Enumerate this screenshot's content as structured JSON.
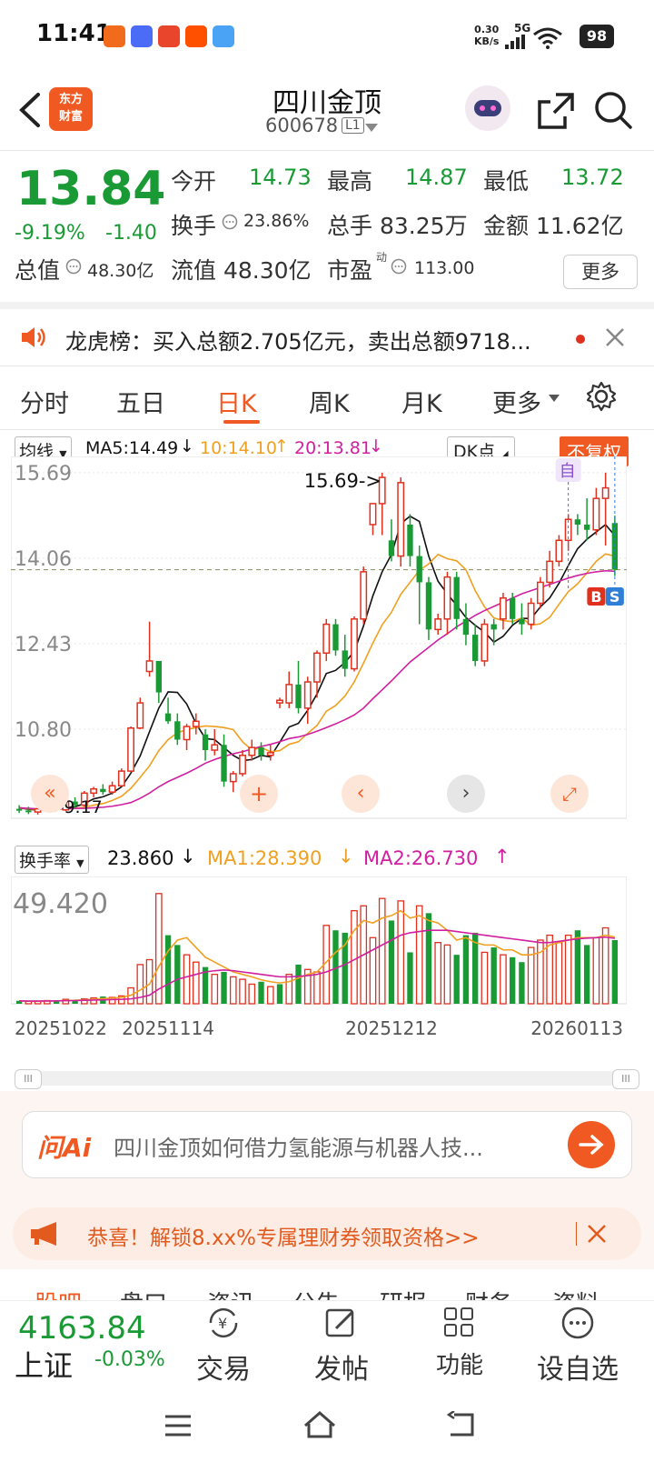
{
  "status_bar": {
    "time": "11:41",
    "net_speed_value": "0.30",
    "net_speed_unit": "KB/s",
    "network": "5G",
    "battery": "98"
  },
  "header": {
    "stock_name": "四川金顶",
    "stock_code": "600678",
    "level": "L1",
    "logo_line1": "东方",
    "logo_line2": "财富"
  },
  "quote": {
    "price": "13.84",
    "change_pct": "-9.19%",
    "change": "-1.40",
    "open_label": "今开",
    "open": "14.73",
    "high_label": "最高",
    "high": "14.87",
    "low_label": "最低",
    "low": "13.72",
    "turnover_label": "换手",
    "turnover": "23.86%",
    "volume_label": "总手",
    "volume": "83.25万",
    "amount_label": "金额",
    "amount": "11.62亿",
    "mktcap_label": "总值",
    "mktcap": "48.30亿",
    "float_label": "流值",
    "float": "48.30亿",
    "pe_label": "市盈",
    "pe_sup": "动",
    "pe": "113.00",
    "more_label": "更多"
  },
  "notice": {
    "text": "龙虎榜：买入总额2.705亿元，卖出总额9718..."
  },
  "kline_tabs": [
    {
      "label": "分时"
    },
    {
      "label": "五日"
    },
    {
      "label": "日K"
    },
    {
      "label": "周K"
    },
    {
      "label": "月K"
    },
    {
      "label": "更多"
    }
  ],
  "chart_legend": {
    "ma_select": "均线",
    "ma5": "MA5:14.49",
    "ma10": "10:14.10",
    "ma20": "20:13.81",
    "dk_select": "DK点",
    "fuquan": "不复权",
    "vol_select": "换手率",
    "vol_val": "23.860",
    "vol_ma1": "MA1:28.390",
    "vol_ma2": "MA2:26.730"
  },
  "colors": {
    "up": "#e0301e",
    "down": "#1a9a35",
    "ma5": "#111111",
    "ma10": "#f0a020",
    "ma20": "#d020a0",
    "accent": "#f05a22"
  },
  "chart_data": {
    "type": "candlestick",
    "y_ticks": [
      "15.69",
      "14.06",
      "12.43",
      "10.80"
    ],
    "ylim": [
      9.1,
      16.0
    ],
    "high_annotation": "15.69->",
    "low_annotation": "<-9.17",
    "markers": {
      "zi": "自",
      "b": "B",
      "s": "S"
    },
    "ohlc": [
      [
        9.28,
        9.35,
        9.2,
        9.25
      ],
      [
        9.25,
        9.32,
        9.18,
        9.22
      ],
      [
        9.22,
        9.3,
        9.17,
        9.28
      ],
      [
        9.28,
        9.36,
        9.22,
        9.3
      ],
      [
        9.3,
        9.38,
        9.25,
        9.26
      ],
      [
        9.26,
        9.45,
        9.24,
        9.42
      ],
      [
        9.42,
        9.5,
        9.3,
        9.35
      ],
      [
        9.35,
        9.62,
        9.32,
        9.58
      ],
      [
        9.58,
        9.7,
        9.5,
        9.66
      ],
      [
        9.66,
        9.75,
        9.55,
        9.6
      ],
      [
        9.6,
        9.8,
        9.55,
        9.72
      ],
      [
        9.72,
        10.05,
        9.7,
        10.0
      ],
      [
        10.0,
        10.85,
        9.98,
        10.82
      ],
      [
        10.82,
        11.4,
        10.8,
        11.3
      ],
      [
        11.9,
        12.85,
        11.8,
        12.1
      ],
      [
        12.1,
        12.1,
        11.3,
        11.5
      ],
      [
        11.1,
        11.4,
        10.9,
        10.95
      ],
      [
        10.95,
        11.1,
        10.5,
        10.6
      ],
      [
        10.6,
        10.9,
        10.4,
        10.85
      ],
      [
        10.85,
        11.1,
        10.7,
        10.95
      ],
      [
        10.7,
        10.8,
        10.2,
        10.4
      ],
      [
        10.4,
        10.8,
        10.3,
        10.5
      ],
      [
        10.5,
        10.7,
        9.7,
        9.8
      ],
      [
        9.8,
        10.0,
        9.6,
        9.95
      ],
      [
        9.95,
        10.4,
        9.9,
        10.3
      ],
      [
        10.3,
        10.6,
        10.2,
        10.45
      ],
      [
        10.45,
        10.55,
        10.2,
        10.3
      ],
      [
        10.3,
        10.5,
        10.2,
        10.35
      ],
      [
        11.3,
        11.4,
        11.2,
        11.35
      ],
      [
        11.3,
        11.9,
        11.2,
        11.65
      ],
      [
        11.65,
        12.1,
        11.1,
        11.2
      ],
      [
        11.2,
        11.8,
        10.9,
        11.7
      ],
      [
        11.7,
        12.3,
        11.4,
        12.25
      ],
      [
        12.25,
        12.9,
        12.1,
        12.8
      ],
      [
        12.8,
        12.9,
        12.2,
        12.3
      ],
      [
        12.3,
        12.6,
        11.8,
        11.95
      ],
      [
        11.95,
        12.95,
        11.9,
        12.9
      ],
      [
        12.9,
        13.9,
        12.8,
        13.8
      ],
      [
        14.7,
        15.0,
        14.5,
        15.1
      ],
      [
        15.1,
        15.69,
        14.5,
        15.6
      ],
      [
        14.4,
        14.8,
        14.0,
        14.1
      ],
      [
        14.1,
        15.6,
        13.9,
        15.5
      ],
      [
        14.7,
        14.9,
        13.9,
        14.1
      ],
      [
        14.1,
        14.3,
        12.8,
        13.6
      ],
      [
        13.6,
        13.7,
        12.5,
        12.7
      ],
      [
        12.7,
        13.0,
        12.6,
        12.9
      ],
      [
        12.9,
        13.8,
        12.6,
        13.7
      ],
      [
        13.7,
        13.8,
        12.7,
        12.9
      ],
      [
        12.9,
        13.2,
        12.4,
        12.6
      ],
      [
        12.6,
        12.8,
        12.0,
        12.1
      ],
      [
        12.1,
        12.9,
        12.0,
        12.8
      ],
      [
        12.8,
        12.9,
        12.4,
        12.7
      ],
      [
        12.9,
        13.4,
        12.7,
        13.3
      ],
      [
        13.3,
        13.4,
        12.8,
        12.9
      ],
      [
        12.9,
        13.2,
        12.6,
        12.8
      ],
      [
        12.8,
        13.3,
        12.7,
        13.2
      ],
      [
        13.2,
        13.7,
        13.1,
        13.6
      ],
      [
        13.6,
        14.2,
        13.5,
        14.0
      ],
      [
        14.0,
        14.5,
        13.9,
        14.4
      ],
      [
        14.4,
        14.9,
        14.2,
        14.8
      ],
      [
        14.8,
        14.9,
        14.5,
        14.7
      ],
      [
        14.7,
        15.2,
        14.4,
        14.6
      ],
      [
        14.6,
        15.4,
        14.5,
        15.2
      ],
      [
        15.2,
        15.69,
        14.3,
        15.4
      ],
      [
        14.73,
        14.87,
        13.72,
        13.84
      ]
    ],
    "ma5": [
      9.3,
      9.27,
      9.26,
      9.27,
      9.26,
      9.3,
      9.32,
      9.38,
      9.47,
      9.51,
      9.58,
      9.7,
      9.96,
      10.29,
      10.75,
      11.2,
      11.51,
      11.5,
      11.28,
      10.91,
      10.62,
      10.6,
      10.45,
      10.3,
      10.2,
      10.22,
      10.3,
      10.27,
      10.55,
      10.84,
      10.91,
      11.16,
      11.47,
      11.86,
      11.92,
      12.07,
      12.28,
      12.77,
      13.34,
      13.8,
      14.13,
      14.72,
      14.86,
      14.76,
      14.1,
      13.62,
      13.38,
      13.16,
      12.93,
      12.78,
      12.65,
      12.46,
      12.57,
      12.78,
      12.91,
      12.91,
      13.13,
      13.3,
      13.58,
      13.92,
      14.24,
      14.42,
      14.56,
      14.7,
      14.49
    ],
    "ma10": [
      9.3,
      9.28,
      9.27,
      9.27,
      9.27,
      9.28,
      9.29,
      9.31,
      9.35,
      9.38,
      9.44,
      9.52,
      9.67,
      9.88,
      10.1,
      10.39,
      10.6,
      10.73,
      10.79,
      10.83,
      10.86,
      10.85,
      10.83,
      10.79,
      10.56,
      10.4,
      10.45,
      10.37,
      10.39,
      10.51,
      10.56,
      10.72,
      10.87,
      11.14,
      11.25,
      11.43,
      11.7,
      12.06,
      12.44,
      12.79,
      13.03,
      13.37,
      13.6,
      13.83,
      13.95,
      14.13,
      14.05,
      14.01,
      13.84,
      13.44,
      13.13,
      12.92,
      12.87,
      12.85,
      12.92,
      12.78,
      12.81,
      12.93,
      13.18,
      13.42,
      13.57,
      13.78,
      14.0,
      14.14,
      14.1
    ],
    "ma20": [
      9.3,
      9.29,
      9.28,
      9.28,
      9.28,
      9.28,
      9.29,
      9.29,
      9.3,
      9.31,
      9.33,
      9.36,
      9.4,
      9.48,
      9.58,
      9.7,
      9.8,
      9.88,
      9.96,
      10.05,
      10.15,
      10.22,
      10.28,
      10.33,
      10.37,
      10.42,
      10.47,
      10.51,
      10.56,
      10.62,
      10.65,
      10.7,
      10.76,
      10.83,
      10.9,
      10.98,
      11.07,
      11.2,
      11.38,
      11.55,
      11.72,
      11.9,
      12.08,
      12.22,
      12.36,
      12.5,
      12.62,
      12.75,
      12.86,
      12.97,
      13.06,
      13.14,
      13.22,
      13.3,
      13.38,
      13.44,
      13.5,
      13.56,
      13.62,
      13.68,
      13.73,
      13.77,
      13.8,
      13.82,
      13.81
    ],
    "volume_max_label": "49.420",
    "volume": [
      1.2,
      1.0,
      1.1,
      1.3,
      1.4,
      1.8,
      1.5,
      2.0,
      2.4,
      3.0,
      2.6,
      3.2,
      6.5,
      16,
      18,
      45,
      28,
      24,
      20,
      17,
      15,
      12,
      13,
      11,
      10,
      8,
      9,
      7,
      8,
      12,
      16,
      14,
      13,
      32,
      30,
      29,
      38,
      40,
      27,
      43,
      34,
      42,
      21,
      40,
      37,
      25,
      24,
      20,
      28,
      29,
      21,
      23,
      20,
      19,
      17,
      23,
      26,
      28,
      25,
      28,
      30,
      24,
      27,
      31,
      26
    ],
    "volume_up": [
      false,
      true,
      true,
      true,
      false,
      true,
      false,
      true,
      true,
      false,
      true,
      true,
      true,
      true,
      true,
      true,
      false,
      false,
      true,
      true,
      false,
      true,
      false,
      true,
      true,
      true,
      false,
      true,
      false,
      true,
      false,
      true,
      true,
      true,
      false,
      false,
      true,
      true,
      true,
      true,
      false,
      true,
      false,
      true,
      false,
      true,
      true,
      false,
      false,
      false,
      true,
      false,
      true,
      false,
      false,
      true,
      true,
      true,
      true,
      true,
      false,
      false,
      true,
      true,
      false
    ],
    "volume_ma1": [
      1.2,
      1.1,
      1.1,
      1.15,
      1.2,
      1.3,
      1.4,
      1.6,
      1.8,
      2.1,
      2.3,
      2.6,
      3.5,
      5.6,
      8.0,
      15.2,
      21.5,
      26,
      27,
      23,
      19,
      17,
      15,
      13,
      12,
      11,
      9.8,
      9.0,
      8.5,
      9.0,
      10.5,
      12,
      13,
      17,
      21,
      24,
      30,
      34,
      33,
      35,
      36,
      38,
      35,
      36,
      34,
      33,
      30,
      26,
      27,
      25,
      24,
      24,
      22,
      22,
      20,
      20,
      21,
      24,
      25,
      26,
      27,
      27,
      27,
      28,
      27.3
    ],
    "volume_ma2": [
      1.2,
      1.1,
      1.1,
      1.15,
      1.2,
      1.25,
      1.3,
      1.4,
      1.5,
      1.6,
      1.7,
      1.8,
      2.0,
      2.6,
      3.5,
      6,
      8,
      10,
      11,
      12,
      13,
      13.5,
      13.8,
      13.5,
      13,
      12.5,
      12,
      11.5,
      11,
      11,
      11.2,
      11.5,
      12,
      13,
      14.5,
      16,
      18,
      20,
      22,
      24,
      26,
      28,
      29,
      29.5,
      30,
      30,
      30,
      29.5,
      29,
      28.5,
      28,
      27.5,
      27,
      26.5,
      26,
      25.5,
      25,
      25,
      25.5,
      26,
      26.5,
      26.8,
      27,
      27.2,
      26.73
    ],
    "x_tick_labels": [
      "20251022",
      "20251114",
      "20251212",
      "20260113"
    ]
  },
  "scroll": {
    "left_grip": "III",
    "right_grip": "III"
  },
  "ai": {
    "logo": "问Ai",
    "placeholder": "四川金顶如何借力氢能源与机器人技..."
  },
  "promo": {
    "text": "恭喜！解锁8.xx%专属理财券领取资格>>"
  },
  "sub_tabs": [
    "股吧",
    "盘口",
    "资讯",
    "公告",
    "研报",
    "财务",
    "资料"
  ],
  "bottom": {
    "index_value": "4163.84",
    "index_name": "上证",
    "index_change": "-0.03%",
    "buttons": [
      {
        "label": "交易",
        "icon": "yen-cycle-icon"
      },
      {
        "label": "发帖",
        "icon": "edit-icon"
      },
      {
        "label": "功能",
        "icon": "grid-icon"
      },
      {
        "label": "设自选",
        "icon": "more-circle-icon"
      }
    ]
  }
}
